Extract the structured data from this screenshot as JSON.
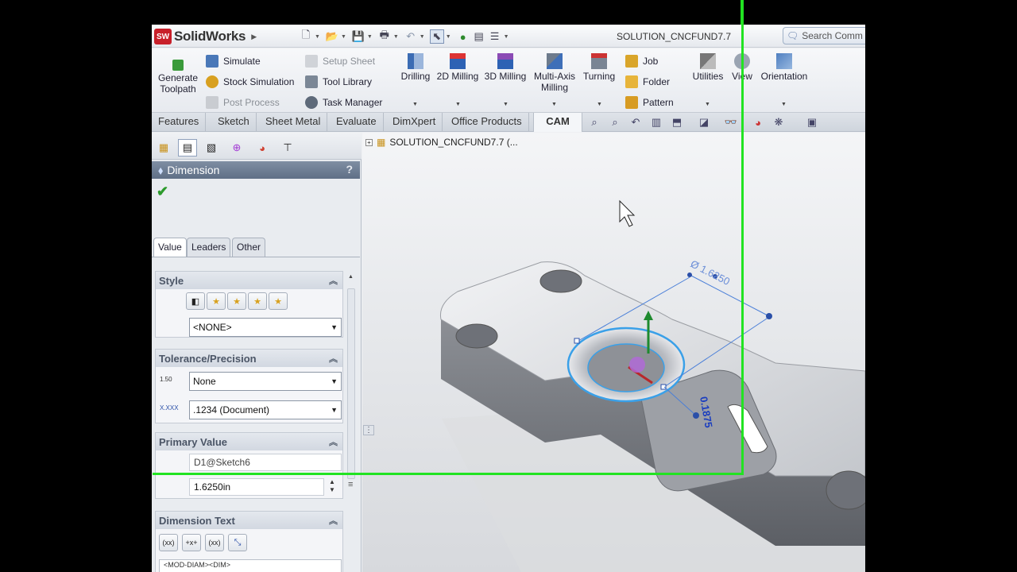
{
  "app": {
    "name": "SolidWorks",
    "logo_text": "SW",
    "document_title": "SOLUTION_CNCFUND7.7",
    "search_placeholder": "Search Comm"
  },
  "ribbon": {
    "generate": "Generate Toolpath",
    "simulate": "Simulate",
    "stock_sim": "Stock Simulation",
    "post_process": "Post Process",
    "setup_sheet": "Setup Sheet",
    "tool_library": "Tool Library",
    "task_manager": "Task Manager",
    "drilling": "Drilling",
    "milling2d": "2D Milling",
    "milling3d": "3D Milling",
    "multiaxis_1": "Multi-Axis",
    "multiaxis_2": "Milling",
    "turning": "Turning",
    "job": "Job",
    "folder": "Folder",
    "pattern": "Pattern",
    "utilities": "Utilities",
    "view": "View",
    "orientation": "Orientation"
  },
  "tabs": [
    "Features",
    "Sketch",
    "Sheet Metal",
    "Evaluate",
    "DimXpert",
    "Office Products",
    "CAM"
  ],
  "tree": {
    "root": "SOLUTION_CNCFUND7.7  (..."
  },
  "panel": {
    "title": "Dimension",
    "help": "?",
    "subtabs": [
      "Value",
      "Leaders",
      "Other"
    ],
    "style": {
      "header": "Style",
      "selected": "<NONE>"
    },
    "tolerance": {
      "header": "Tolerance/Precision",
      "tol_type": "None",
      "precision": ".1234 (Document)",
      "tol_icon_text": "1.50",
      "prec_icon_text": "X.XXX"
    },
    "primary": {
      "header": "Primary Value",
      "name": "D1@Sketch6",
      "value": "1.6250in"
    },
    "dimtext": {
      "header": "Dimension Text",
      "content": "<MOD-DIAM><DIM>",
      "btn1": "(xx)",
      "btn2": "+x+",
      "btn3": "(xx)"
    }
  },
  "model": {
    "dim_diameter": "Ø 1.6250",
    "dim_depth": "0.1875"
  },
  "colors": {
    "accent_green": "#22e322",
    "panel_header": "#6a7a90",
    "dim_blue": "#1a3dbf"
  }
}
